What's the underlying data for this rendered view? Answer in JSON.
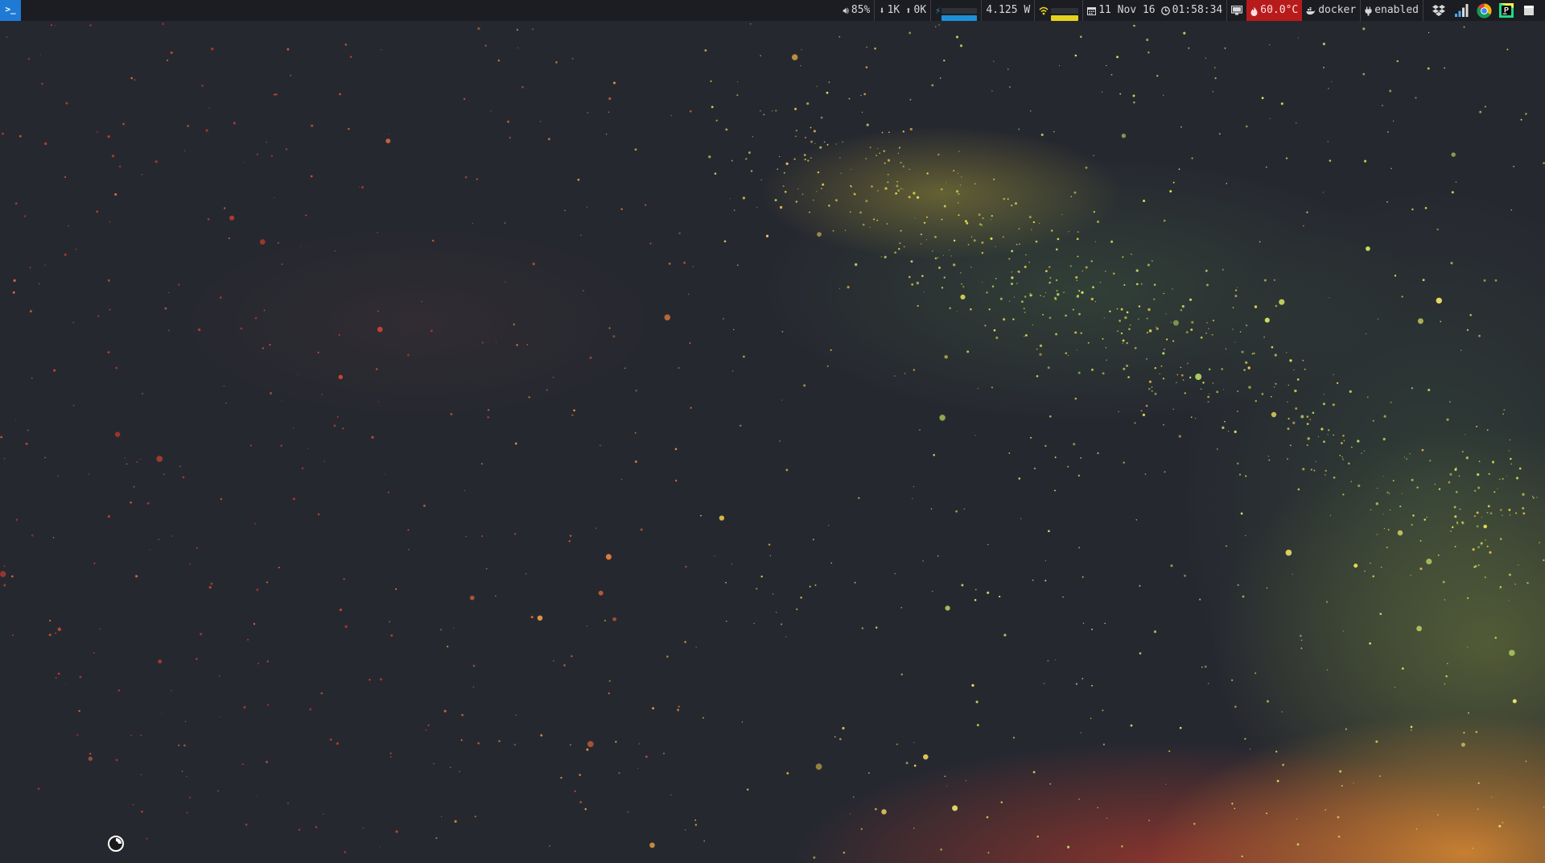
{
  "launcher": {
    "label": ">_"
  },
  "status": {
    "volume": "85%",
    "net_down": "1K",
    "net_up": "0K",
    "battery_level": 1.0,
    "power": "4.125 W",
    "wifi_level": 1.0,
    "date": "11 Nov 16",
    "time": "01:58:34",
    "temperature": "60.0°C",
    "docker": "docker",
    "service_status": "enabled"
  },
  "tray": [
    {
      "name": "dropbox-icon"
    },
    {
      "name": "signal-strength-icon"
    },
    {
      "name": "chrome-icon"
    },
    {
      "name": "pycharm-icon"
    },
    {
      "name": "window-icon"
    }
  ],
  "colors": {
    "bar_bg": "#1b1d22",
    "launcher": "#1f7ad6",
    "battery_bar": "#1e90d8",
    "wifi_bar": "#e6d21e",
    "temperature_alert": "#b81b1b",
    "wallpaper_base": "#262830"
  }
}
